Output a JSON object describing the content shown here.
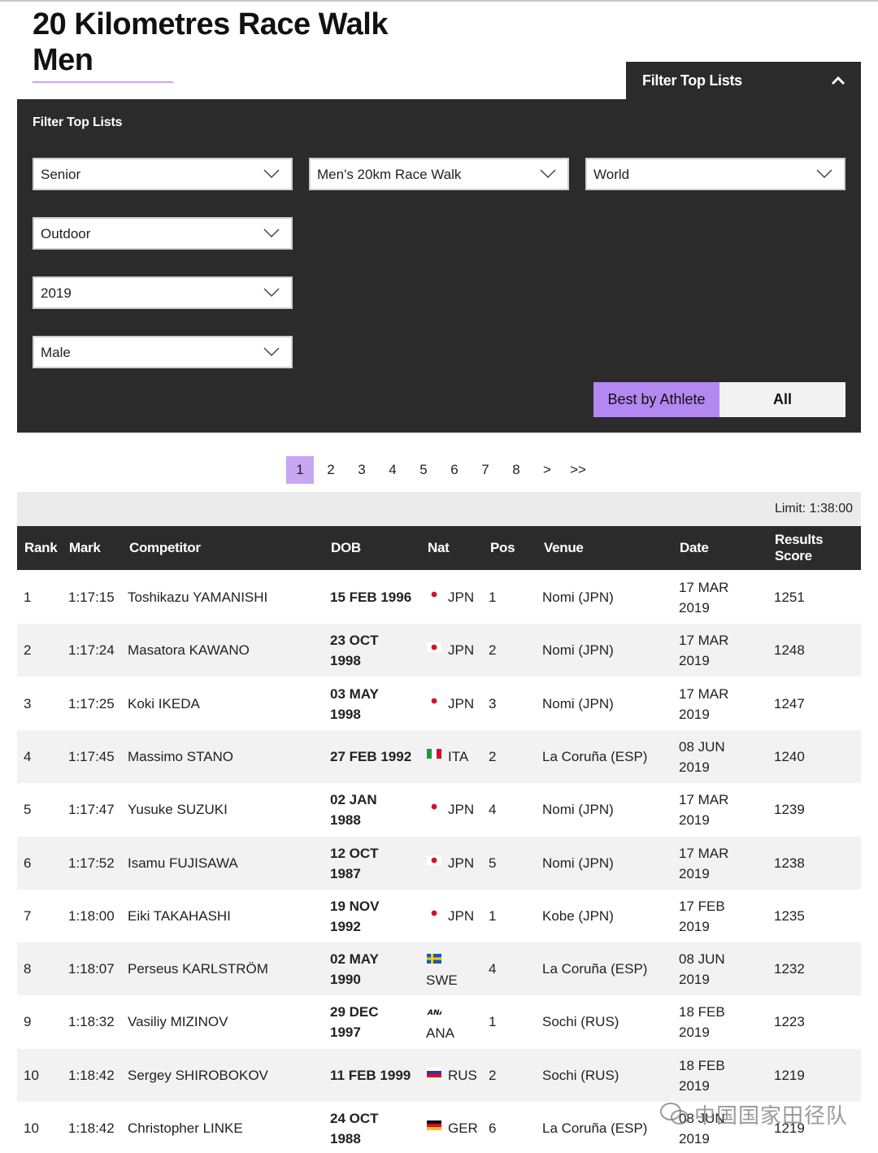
{
  "title": {
    "line1": "20 Kilometres Race Walk",
    "line2": "Men"
  },
  "filter_tab": {
    "label": "Filter Top Lists"
  },
  "filter_panel": {
    "heading": "Filter Top Lists",
    "selects": {
      "age": "Senior",
      "discipline": "Men's 20km Race Walk",
      "region": "World",
      "environment": "Outdoor",
      "year": "2019",
      "gender": "Male"
    },
    "toggle": {
      "best": "Best by Athlete",
      "all": "All"
    }
  },
  "pagination": {
    "pages": [
      "1",
      "2",
      "3",
      "4",
      "5",
      "6",
      "7",
      "8",
      ">",
      ">>"
    ],
    "active": "1"
  },
  "limit": "Limit: 1:38:00",
  "columns": {
    "rank": "Rank",
    "mark": "Mark",
    "competitor": "Competitor",
    "dob": "DOB",
    "nat": "Nat",
    "pos": "Pos",
    "venue": "Venue",
    "date": "Date",
    "score1": "Results",
    "score2": "Score"
  },
  "rows": [
    {
      "rank": "1",
      "mark": "1:17:15",
      "name": "Toshikazu YAMANISHI",
      "dob1": "15 FEB 1996",
      "dob2": "",
      "nat": "JPN",
      "flag": "jpn",
      "pos": "1",
      "venue": "Nomi (JPN)",
      "date1": "17 MAR",
      "date2": "2019",
      "score": "1251"
    },
    {
      "rank": "2",
      "mark": "1:17:24",
      "name": "Masatora KAWANO",
      "dob1": "23 OCT",
      "dob2": "1998",
      "nat": "JPN",
      "flag": "jpn",
      "pos": "2",
      "venue": "Nomi (JPN)",
      "date1": "17 MAR",
      "date2": "2019",
      "score": "1248"
    },
    {
      "rank": "3",
      "mark": "1:17:25",
      "name": "Koki IKEDA",
      "dob1": "03 MAY",
      "dob2": "1998",
      "nat": "JPN",
      "flag": "jpn",
      "pos": "3",
      "venue": "Nomi (JPN)",
      "date1": "17 MAR",
      "date2": "2019",
      "score": "1247"
    },
    {
      "rank": "4",
      "mark": "1:17:45",
      "name": "Massimo STANO",
      "dob1": "27 FEB 1992",
      "dob2": "",
      "nat": "ITA",
      "flag": "ita",
      "pos": "2",
      "venue": "La Coruña (ESP)",
      "date1": "08 JUN",
      "date2": "2019",
      "score": "1240"
    },
    {
      "rank": "5",
      "mark": "1:17:47",
      "name": "Yusuke SUZUKI",
      "dob1": "02 JAN",
      "dob2": "1988",
      "nat": "JPN",
      "flag": "jpn",
      "pos": "4",
      "venue": "Nomi (JPN)",
      "date1": "17 MAR",
      "date2": "2019",
      "score": "1239"
    },
    {
      "rank": "6",
      "mark": "1:17:52",
      "name": "Isamu FUJISAWA",
      "dob1": "12 OCT",
      "dob2": "1987",
      "nat": "JPN",
      "flag": "jpn",
      "pos": "5",
      "venue": "Nomi (JPN)",
      "date1": "17 MAR",
      "date2": "2019",
      "score": "1238"
    },
    {
      "rank": "7",
      "mark": "1:18:00",
      "name": "Eiki TAKAHASHI",
      "dob1": "19 NOV",
      "dob2": "1992",
      "nat": "JPN",
      "flag": "jpn",
      "pos": "1",
      "venue": "Kobe (JPN)",
      "date1": "17 FEB",
      "date2": "2019",
      "score": "1235"
    },
    {
      "rank": "8",
      "mark": "1:18:07",
      "name": "Perseus KARLSTRÖM",
      "dob1": "02 MAY",
      "dob2": "1990",
      "nat": "SWE",
      "flag": "swe",
      "pos": "4",
      "venue": "La Coruña (ESP)",
      "date1": "08 JUN",
      "date2": "2019",
      "score": "1232"
    },
    {
      "rank": "9",
      "mark": "1:18:32",
      "name": "Vasiliy MIZINOV",
      "dob1": "29 DEC",
      "dob2": "1997",
      "nat": "ANA",
      "flag": "ana",
      "pos": "1",
      "venue": "Sochi (RUS)",
      "date1": "18 FEB",
      "date2": "2019",
      "score": "1223"
    },
    {
      "rank": "10",
      "mark": "1:18:42",
      "name": "Sergey SHIROBOKOV",
      "dob1": "11 FEB 1999",
      "dob2": "",
      "nat": "RUS",
      "flag": "rus",
      "pos": "2",
      "venue": "Sochi (RUS)",
      "date1": "18 FEB",
      "date2": "2019",
      "score": "1219"
    },
    {
      "rank": "10",
      "mark": "1:18:42",
      "name": "Christopher LINKE",
      "dob1": "24 OCT",
      "dob2": "1988",
      "nat": "GER",
      "flag": "ger",
      "pos": "6",
      "venue": "La Coruña (ESP)",
      "date1": "08 JUN",
      "date2": "2019",
      "score": "1219"
    }
  ],
  "flag_label": {
    "ana": "ANA"
  },
  "watermark": "中国国家田径队",
  "colors": {
    "panel": "#2b2b2b",
    "accent": "#b388f0",
    "row_alt": "#f2f2f2"
  }
}
